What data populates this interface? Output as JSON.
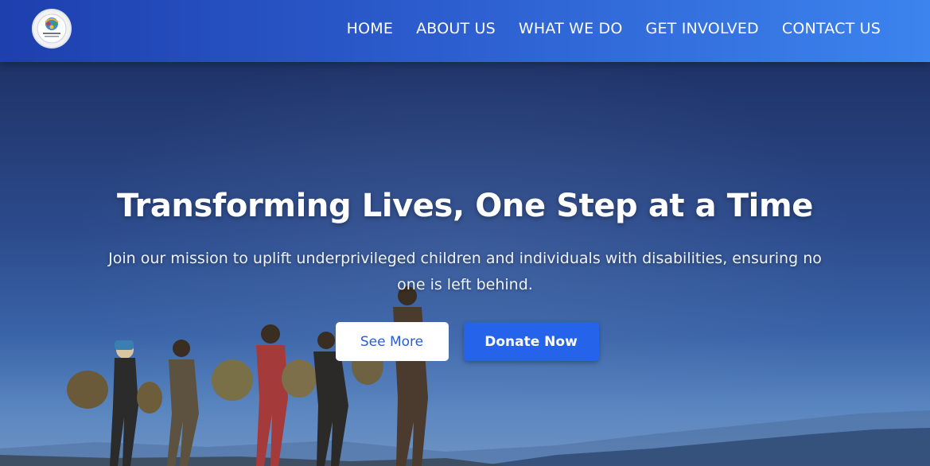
{
  "brand": {
    "logo_icon": "organization-logo-icon"
  },
  "nav": {
    "items": [
      {
        "label": "HOME"
      },
      {
        "label": "ABOUT US"
      },
      {
        "label": "WHAT WE DO"
      },
      {
        "label": "GET INVOLVED"
      },
      {
        "label": "CONTACT US"
      }
    ]
  },
  "hero": {
    "title": "Transforming Lives, One Step at a Time",
    "subtitle": "Join our mission to uplift underprivileged children and individuals with disabilities, ensuring no one is left behind.",
    "buttons": {
      "see_more": "See More",
      "donate": "Donate Now"
    }
  },
  "colors": {
    "nav_start": "#1e3fae",
    "nav_end": "#3c84ef",
    "primary_button": "#2563eb",
    "light_button_text": "#2a5ed8"
  }
}
